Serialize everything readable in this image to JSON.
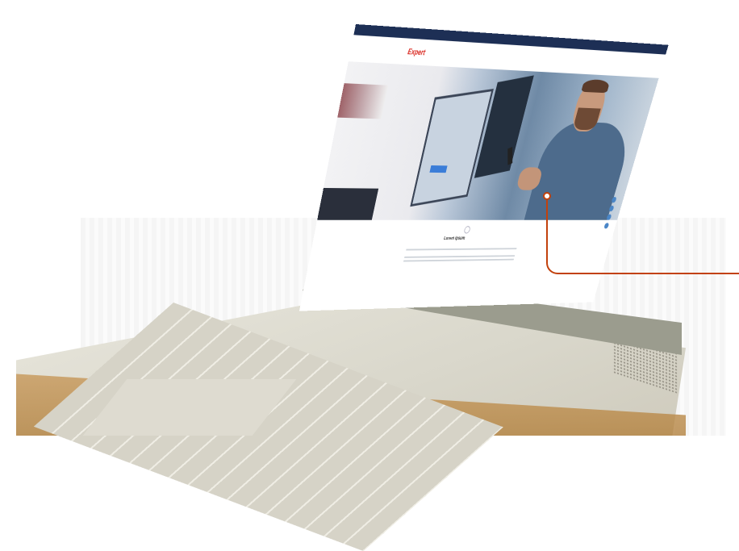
{
  "scene": {
    "description_icon": "laptop-icon",
    "accent_color": "#c2410c"
  },
  "website": {
    "logo": "Expert",
    "hero_title": "",
    "hero_sub": "",
    "cta": "",
    "section_heading": "Lorem ipsum"
  },
  "colors": {
    "topbar": "#1d2f55",
    "logo_red": "#d9251d",
    "accent_blue": "#2f6fb3"
  }
}
